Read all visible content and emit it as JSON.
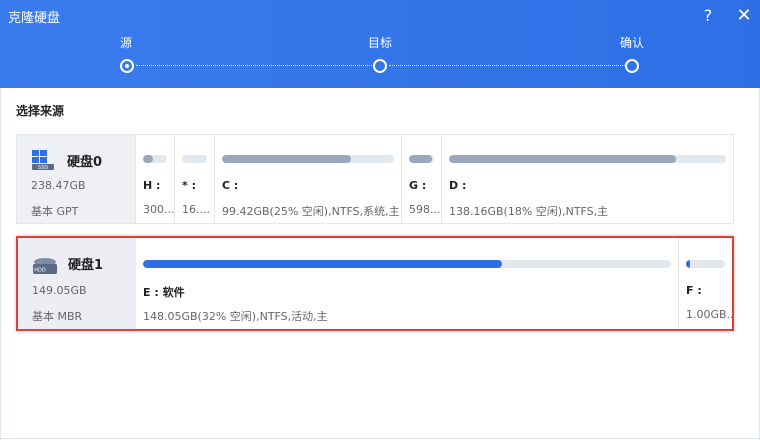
{
  "window": {
    "title": "克隆硬盘",
    "help_label": "?",
    "close_label": "✕"
  },
  "steps": [
    {
      "label": "源",
      "state": "active"
    },
    {
      "label": "目标",
      "state": "pending"
    },
    {
      "label": "确认",
      "state": "pending"
    }
  ],
  "section_title": "选择来源",
  "disks": [
    {
      "name": "硬盘0",
      "size": "238.47GB",
      "type": "基本 GPT",
      "icon": "ssd-icon",
      "selected": false,
      "partitions": [
        {
          "label": "H :",
          "detail": "300...",
          "used_fraction": 0.4
        },
        {
          "label": "* :",
          "detail": "16....",
          "used_fraction": 0.0
        },
        {
          "label": "C :",
          "detail": "99.42GB(25% 空闲),NTFS,系统,主",
          "used_fraction": 0.75
        },
        {
          "label": "G :",
          "detail": "598....",
          "used_fraction": 0.9
        },
        {
          "label": "D :",
          "detail": "138.16GB(18% 空闲),NTFS,主",
          "used_fraction": 0.82
        }
      ]
    },
    {
      "name": "硬盘1",
      "size": "149.05GB",
      "type": "基本 MBR",
      "icon": "hdd-icon",
      "selected": true,
      "partitions": [
        {
          "label": "E : 软件",
          "detail": "148.05GB(32% 空闲),NTFS,活动,主",
          "used_fraction": 0.68
        },
        {
          "label": "F :",
          "detail": "1.00GB...",
          "used_fraction": 0.1
        }
      ]
    }
  ],
  "colors": {
    "header": "#2f6fe6",
    "accent": "#2f6fe6",
    "selected_border": "#d9413a",
    "used_bar": "#9aa8bc"
  }
}
